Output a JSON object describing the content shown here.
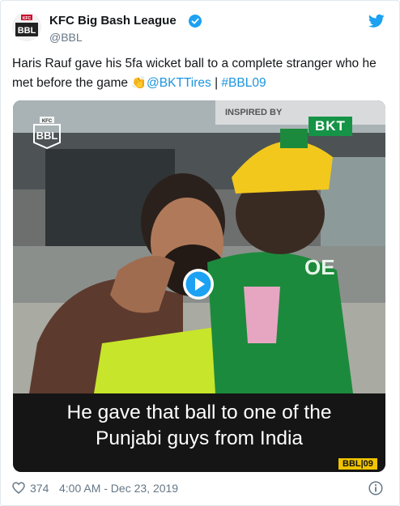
{
  "author": {
    "name": "KFC Big Bash League",
    "handle": "@BBL",
    "avatar_text": "BBL",
    "avatar_badge": "KFC"
  },
  "tweet": {
    "text_before": "Haris Rauf gave his 5fa wicket ball to a complete stranger who he met before the game ",
    "emoji": "👏",
    "mention": "@BKTTires",
    "separator": " | ",
    "hashtag": "#BBL09"
  },
  "media": {
    "caption_line1": "He gave that ball to one of the",
    "caption_line2": "Punjabi guys from India",
    "sponsor": "BKT",
    "watermark": "BBL|09",
    "logo_text": "BBL",
    "logo_badge": "KFC",
    "background_sign": "INSPIRED BY"
  },
  "footer": {
    "likes": "374",
    "timestamp": "4:00 AM - Dec 23, 2019"
  },
  "colors": {
    "link": "#1b95e0",
    "verified": "#1da1f2",
    "twitter_bird": "#1da1f2",
    "sponsor_green": "#159447"
  },
  "icons": {
    "verified": "verified-badge-icon",
    "twitter": "twitter-bird-icon",
    "like": "heart-icon",
    "info": "info-icon",
    "play": "play-icon"
  }
}
